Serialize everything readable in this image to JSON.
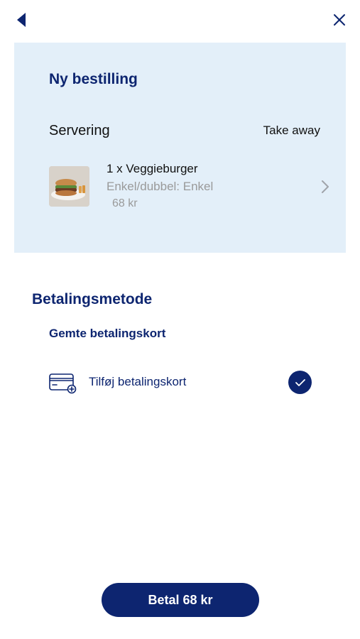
{
  "nav": {
    "back_icon": "back-triangle-icon",
    "close_icon": "close-icon"
  },
  "order": {
    "title": "Ny bestilling",
    "serving_label": "Servering",
    "serving_value": "Take away",
    "item": {
      "name": "1 x Veggieburger",
      "option": "Enkel/dubbel: Enkel",
      "price": "68 kr",
      "image_icon": "veggieburger-photo"
    }
  },
  "payment": {
    "heading": "Betalingsmetode",
    "saved_cards_heading": "Gemte betalingskort",
    "add_card_label": "Tilføj betalingskort",
    "add_card_icon": "credit-card-add-icon",
    "selected_icon": "checkmark-icon"
  },
  "pay_button": {
    "label": "Betal 68 kr"
  },
  "colors": {
    "primary": "#0d2570",
    "card_background": "#e3eff9",
    "muted_text": "#9a9a9a"
  }
}
